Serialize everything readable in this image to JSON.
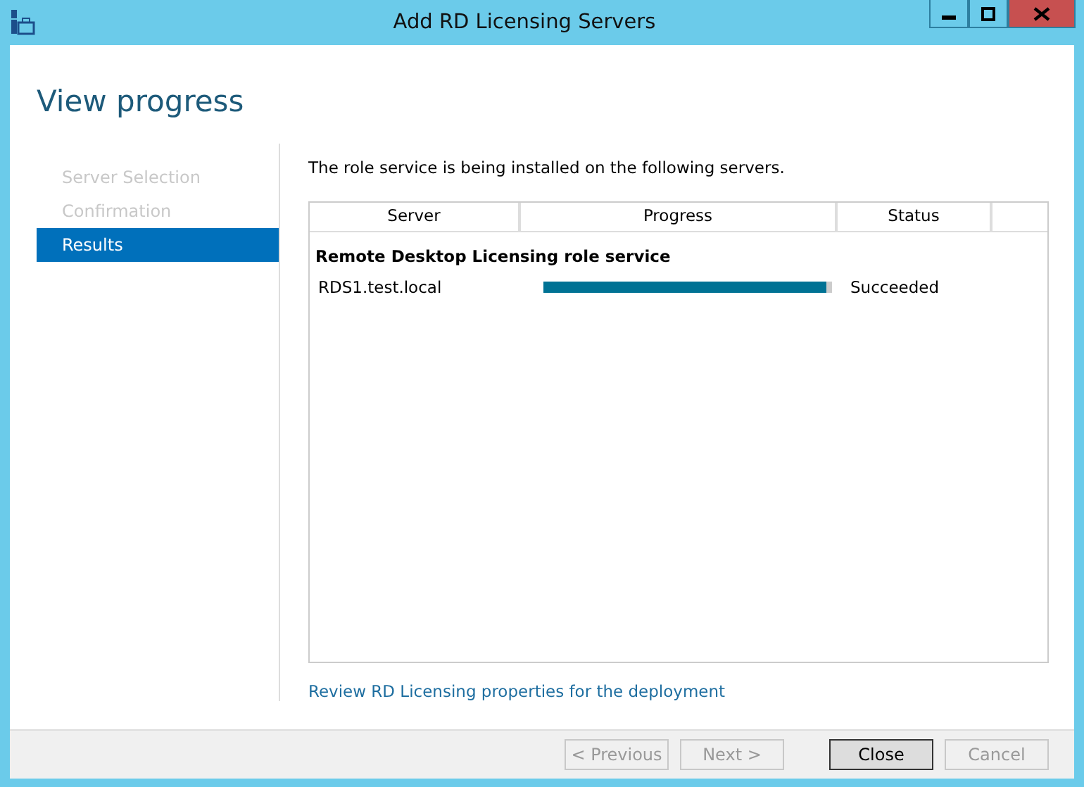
{
  "window": {
    "title": "Add RD Licensing Servers"
  },
  "heading": "View progress",
  "steps": [
    {
      "label": "Server Selection",
      "selected": false,
      "disabled": true
    },
    {
      "label": "Confirmation",
      "selected": false,
      "disabled": true
    },
    {
      "label": "Results",
      "selected": true,
      "disabled": false
    }
  ],
  "intro": "The role service is being installed on the following servers.",
  "table": {
    "columns": [
      "Server",
      "Progress",
      "Status"
    ],
    "groups": [
      {
        "title": "Remote Desktop Licensing role service",
        "rows": [
          {
            "server": "RDS1.test.local",
            "level": 0.98,
            "status": "Succeeded"
          }
        ]
      }
    ]
  },
  "link": "Review RD Licensing properties for the deployment",
  "buttons": [
    {
      "label": "< Previous",
      "disabled": true,
      "default": false
    },
    {
      "label": "Next >",
      "disabled": true,
      "default": false
    },
    {
      "label": "Close",
      "disabled": false,
      "default": true
    },
    {
      "label": "Cancel",
      "disabled": true,
      "default": false
    }
  ]
}
